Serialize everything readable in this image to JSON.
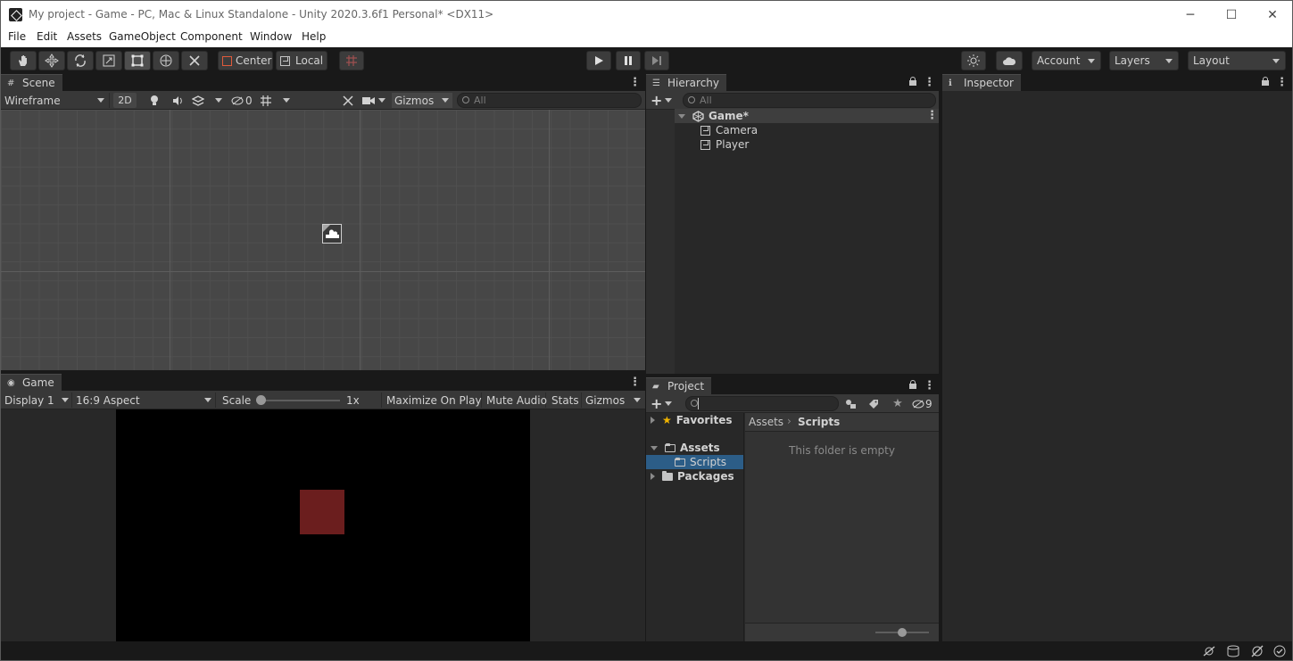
{
  "window": {
    "title": "My project - Game - PC, Mac & Linux Standalone - Unity 2020.3.6f1 Personal* <DX11>",
    "minimize": "─",
    "maximize": "☐",
    "close": "✕"
  },
  "menu": [
    "File",
    "Edit",
    "Assets",
    "GameObject",
    "Component",
    "Window",
    "Help"
  ],
  "toolbar": {
    "pivot_label": "Center",
    "space_label": "Local",
    "account_label": "Account",
    "layers_label": "Layers",
    "layout_label": "Layout"
  },
  "scene": {
    "tab_label": "Scene",
    "draw_mode": "Wireframe",
    "mode_2d": "2D",
    "hidden_count": "0",
    "gizmos_label": "Gizmos",
    "search_placeholder": "All"
  },
  "game": {
    "tab_label": "Game",
    "display": "Display 1",
    "aspect": "16:9 Aspect",
    "scale_label": "Scale",
    "scale_value": "1x",
    "scale_slider_value": 0,
    "maximize_label": "Maximize On Play",
    "mute_label": "Mute Audio",
    "stats_label": "Stats",
    "gizmos_label": "Gizmos",
    "object_color": "#6b1e1e"
  },
  "hierarchy": {
    "tab_label": "Hierarchy",
    "search_placeholder": "All",
    "scene_name": "Game*",
    "items": [
      {
        "label": "Camera"
      },
      {
        "label": "Player"
      }
    ]
  },
  "inspector": {
    "tab_label": "Inspector"
  },
  "project": {
    "tab_label": "Project",
    "search_value": "",
    "hidden_count": "9",
    "tree": {
      "favorites": "Favorites",
      "assets": "Assets",
      "scripts": "Scripts",
      "packages": "Packages"
    },
    "breadcrumb": [
      "Assets",
      "Scripts"
    ],
    "empty_message": "This folder is empty",
    "zoom_slider_value": 0.5
  },
  "colors": {
    "selection": "#2c5d87",
    "accent_star": "#f0b400"
  }
}
